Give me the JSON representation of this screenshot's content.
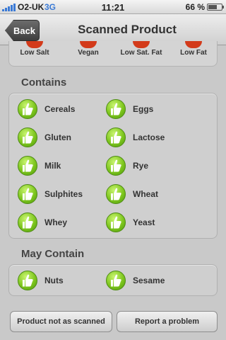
{
  "status_bar": {
    "carrier": "O2-UK",
    "network": "3G",
    "time": "11:21",
    "battery_percent": "66 %",
    "battery_level": 0.66
  },
  "nav": {
    "back_label": "Back",
    "title": "Scanned Product"
  },
  "properties": [
    "Low Salt",
    "Vegan",
    "Low Sat. Fat",
    "Low Fat"
  ],
  "contains": {
    "title": "Contains",
    "items": [
      "Cereals",
      "Eggs",
      "Gluten",
      "Lactose",
      "Milk",
      "Rye",
      "Sulphites",
      "Wheat",
      "Whey",
      "Yeast"
    ]
  },
  "may_contain": {
    "title": "May Contain",
    "items": [
      "Nuts",
      "Sesame"
    ]
  },
  "buttons": {
    "not_as_scanned": "Product not as scanned",
    "report": "Report a problem"
  },
  "colors": {
    "accent_green": "#7ec61e",
    "property_red": "#d33a1a",
    "network_blue": "#3a7ad6"
  }
}
